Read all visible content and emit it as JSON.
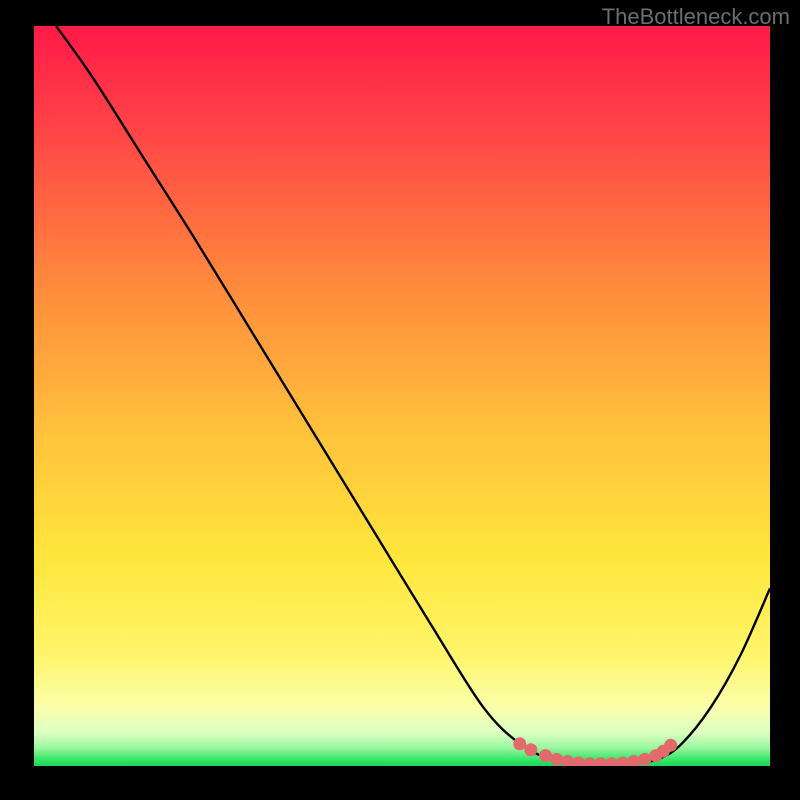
{
  "watermark": "TheBottleneck.com",
  "chart_data": {
    "type": "line",
    "title": "",
    "xlabel": "",
    "ylabel": "",
    "xlim": [
      0,
      100
    ],
    "ylim": [
      0,
      100
    ],
    "series": [
      {
        "name": "curve",
        "x": [
          3,
          8,
          15,
          22,
          30,
          38,
          46,
          54,
          61,
          66,
          70,
          73,
          76,
          79,
          82,
          85,
          88,
          92,
          96,
          100
        ],
        "y": [
          100,
          93,
          82,
          71,
          58,
          45,
          32,
          19,
          8,
          3,
          1,
          0.4,
          0.2,
          0.2,
          0.4,
          1,
          3,
          8,
          15,
          24
        ]
      }
    ],
    "highlight_points": {
      "name": "optimal-range",
      "color": "#e36a6a",
      "x": [
        66,
        67.5,
        69.5,
        71,
        72.5,
        74,
        75.5,
        77,
        78.5,
        80,
        81.5,
        83,
        84.5,
        85.5,
        86.5
      ],
      "y": [
        3,
        2.2,
        1.4,
        0.9,
        0.6,
        0.4,
        0.3,
        0.3,
        0.3,
        0.4,
        0.6,
        0.9,
        1.4,
        2,
        2.8
      ]
    },
    "gradient": {
      "stops": [
        {
          "offset": 0,
          "color": "#ff1a47"
        },
        {
          "offset": 0.15,
          "color": "#ff4747"
        },
        {
          "offset": 0.35,
          "color": "#ff8a3c"
        },
        {
          "offset": 0.55,
          "color": "#ffc23c"
        },
        {
          "offset": 0.72,
          "color": "#ffe63c"
        },
        {
          "offset": 0.85,
          "color": "#fff56b"
        },
        {
          "offset": 0.92,
          "color": "#fbffaa"
        },
        {
          "offset": 0.955,
          "color": "#dcffc2"
        },
        {
          "offset": 0.975,
          "color": "#9cf7a0"
        },
        {
          "offset": 0.99,
          "color": "#3de86b"
        },
        {
          "offset": 1,
          "color": "#17d65a"
        }
      ]
    }
  }
}
